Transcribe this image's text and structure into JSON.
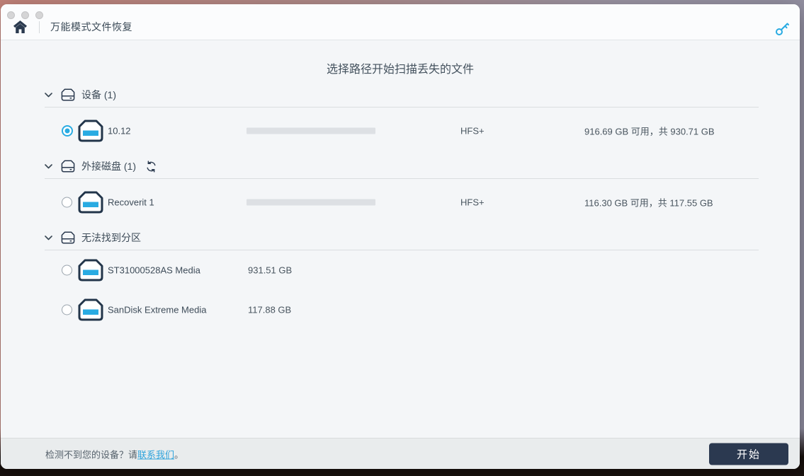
{
  "colors": {
    "accent_blue": "#29abe2",
    "dark_navy": "#2b3950",
    "icon_navy": "#2b3a4f"
  },
  "header": {
    "title": "万能模式文件恢复"
  },
  "main": {
    "heading": "选择路径开始扫描丢失的文件",
    "sections": [
      {
        "label": "设备 (1)",
        "rows": [
          {
            "name": "10.12",
            "selected": true,
            "used_percent": 2.2,
            "fs": "HFS+",
            "capacity": "916.69 GB 可用，共 930.71 GB"
          }
        ]
      },
      {
        "label": "外接磁盘 (1)",
        "has_refresh": true,
        "rows": [
          {
            "name": "Recoverit 1",
            "selected": false,
            "used_percent": 2,
            "fs": "HFS+",
            "capacity": "116.30 GB 可用，共 117.55 GB"
          }
        ]
      },
      {
        "label": "无法找到分区",
        "rows": [
          {
            "name": "ST31000528AS Media",
            "selected": false,
            "size": "931.51 GB"
          },
          {
            "name": "SanDisk Extreme Media",
            "selected": false,
            "size": "117.88 GB"
          }
        ]
      }
    ]
  },
  "footer": {
    "hint_prefix": "检测不到您的设备？请",
    "contact_link": "联系我们",
    "hint_suffix": "。",
    "start_label": "开始"
  }
}
